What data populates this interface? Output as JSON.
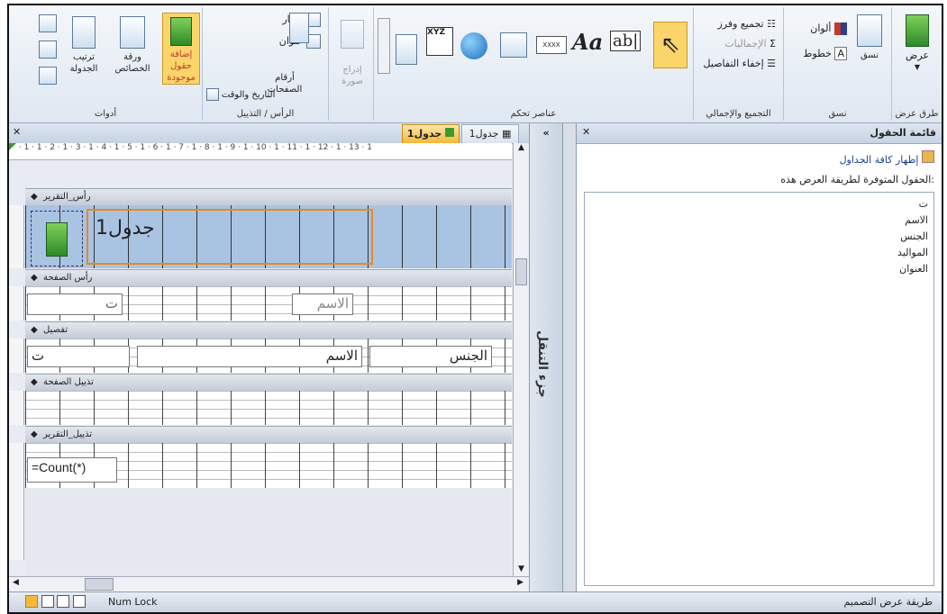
{
  "ribbon": {
    "views": {
      "button": "عرض",
      "group": "طرق عرض"
    },
    "format": {
      "themes": "ألوان",
      "fonts": "خطوط",
      "layout": "نسق",
      "group": "نسق"
    },
    "grouping": {
      "group_sort": "تجميع وفرز",
      "totals": "الإجماليات",
      "hide_details": "إخفاء التفاصيل",
      "group": "التجميع والإجمالي"
    },
    "controls": {
      "aa": "Aa",
      "ab": "ab|",
      "xyz": "XYZ",
      "xxxx": "XXXX",
      "group": "عناصر تحكم"
    },
    "insert_image": {
      "label": "إدراج صورة",
      "group": ""
    },
    "header_footer": {
      "logo": "شعار",
      "title": "عنوان",
      "page_numbers": "أرقام الصفحات",
      "date_time": "التاريخ والوقت",
      "group": "الرأس / التذييل"
    },
    "tools": {
      "add_fields": "إضافة حقول موجودة",
      "properties": "ورقة الخصائص",
      "tab_order": "ترتيب الجدولة",
      "group": "أدوات"
    }
  },
  "field_list": {
    "title": "قائمة الحقول",
    "show_all": "إظهار كافة الجداول",
    "available_label": "الحقول المتوفرة لطريقة العرض هذه:",
    "fields": [
      "ت",
      "الاسم",
      "الجنس",
      "المواليد",
      "العنوان"
    ]
  },
  "nav_pane": {
    "label": "جزء التنقل",
    "collapse": "«"
  },
  "designer": {
    "tabs": [
      {
        "label": "جدول1"
      },
      {
        "label": "جدول1"
      }
    ],
    "ruler": "· 1 · 1 · 2 · 1 · 3 · 1 · 4 · 1 · 5 · 1 · 6 · 1 · 7 · 1 · 8 · 1 · 9 · 1 · 10 · 1 · 11 · 1 · 12 · 1 · 13 · 1",
    "sections": {
      "report_header": "رأس_التقرير",
      "page_header": "رأس الصفحة",
      "detail": "تفصيل",
      "page_footer": "تذييل الصفحة",
      "report_footer": "تذييل_التقرير"
    },
    "report_title": "جدول1",
    "page_header_labels": {
      "seq": "ت",
      "name": "الاسم"
    },
    "detail_fields": {
      "seq": "ت",
      "name": "الاسم",
      "gender": "الجنس"
    },
    "count_expr": "=Count(*)"
  },
  "status": {
    "num_lock": "Num Lock",
    "mode": "طريقة عرض التصميم"
  }
}
